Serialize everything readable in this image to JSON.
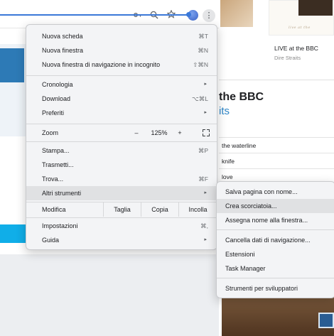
{
  "page": {
    "album_title": "LIVE at the BBC",
    "album_artist": "Dire Straits",
    "heading": "the BBC",
    "subheading": "its",
    "cover_caption": "live at the",
    "tracks": [
      "the waterline",
      "knife",
      "love"
    ]
  },
  "toolbar": {
    "icons": [
      "key-icon",
      "zoom-icon",
      "star-icon"
    ],
    "menu_glyph": "⋮"
  },
  "menu": {
    "new_tab": {
      "label": "Nuova scheda",
      "shortcut": "⌘T"
    },
    "new_window": {
      "label": "Nuova finestra",
      "shortcut": "⌘N"
    },
    "new_incognito": {
      "label": "Nuova finestra di navigazione in incognito",
      "shortcut": "⇧⌘N"
    },
    "history": {
      "label": "Cronologia"
    },
    "downloads": {
      "label": "Download",
      "shortcut": "⌥⌘L"
    },
    "bookmarks": {
      "label": "Preferiti"
    },
    "zoom": {
      "label": "Zoom",
      "minus": "–",
      "value": "125%",
      "plus": "+"
    },
    "print": {
      "label": "Stampa...",
      "shortcut": "⌘P"
    },
    "cast": {
      "label": "Trasmetti..."
    },
    "find": {
      "label": "Trova...",
      "shortcut": "⌘F"
    },
    "more_tools": {
      "label": "Altri strumenti"
    },
    "edit": {
      "label": "Modifica",
      "cut": "Taglia",
      "copy": "Copia",
      "paste": "Incolla"
    },
    "settings": {
      "label": "Impostazioni",
      "shortcut": "⌘,"
    },
    "help": {
      "label": "Guida"
    },
    "arrow_glyph": "▸"
  },
  "submenu": {
    "items": [
      "Salva pagina con nome...",
      "Crea scorciatoia...",
      "Assegna nome alla finestra...",
      "Cancella dati di navigazione...",
      "Estensioni",
      "Task Manager",
      "Strumenti per sviluppatori"
    ],
    "highlighted_index": 1
  },
  "colors": {
    "menu_bg": "#f3f4f6",
    "highlight": "#e0e1e3",
    "accent_blue": "#3a78d8",
    "link_blue": "#2e86c8"
  }
}
